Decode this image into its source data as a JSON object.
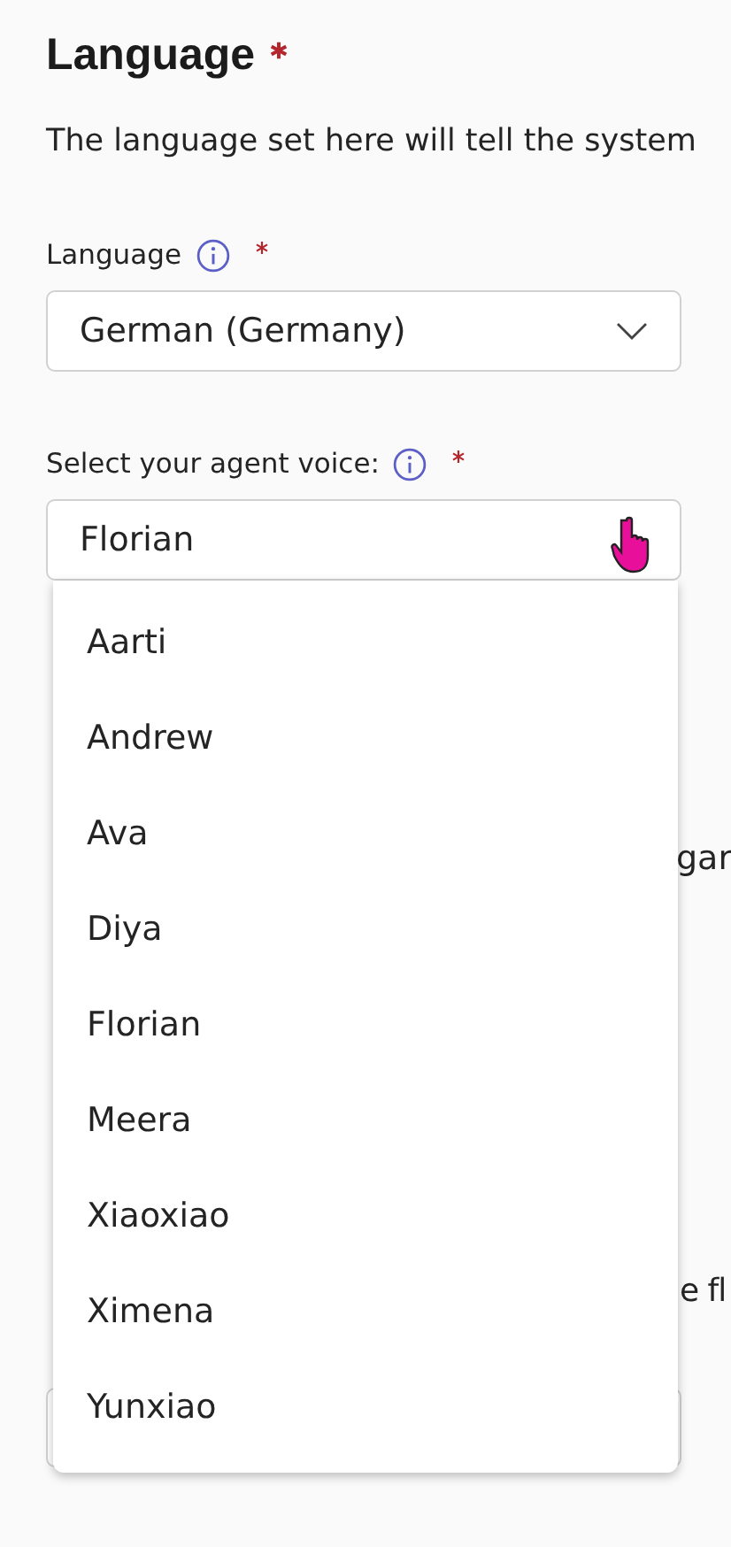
{
  "heading": {
    "text": "Language",
    "required": true
  },
  "description": "The language set here will tell the system",
  "fields": [
    {
      "label": "Language",
      "info": true,
      "required": true,
      "value": "German (Germany)",
      "chevron": true
    },
    {
      "label": "Select your agent voice:",
      "info": true,
      "required": true,
      "value": "Florian",
      "chevron": false
    }
  ],
  "dropdown": {
    "options": [
      "Aarti",
      "Andrew",
      "Ava",
      "Diya",
      "Florian",
      "Meera",
      "Xiaoxiao",
      "Ximena",
      "Yunxiao"
    ]
  },
  "covered": {
    "fragments": [
      "gar",
      "e fl"
    ]
  }
}
